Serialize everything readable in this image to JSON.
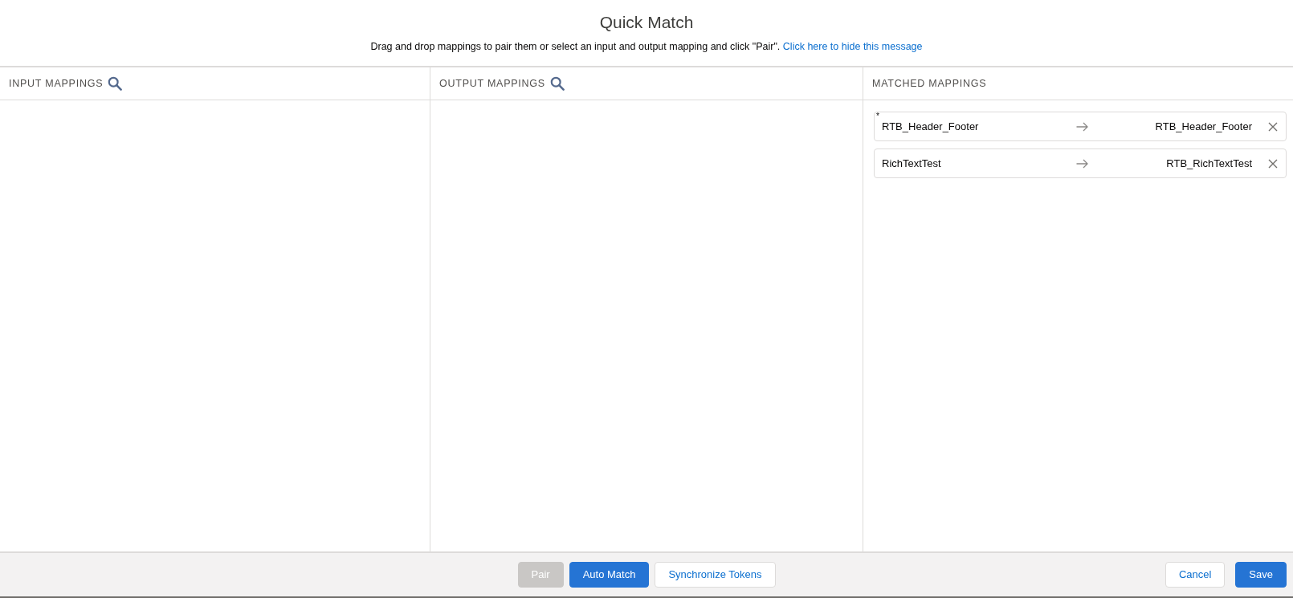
{
  "dialog": {
    "title": "Quick Match",
    "message": "Drag and drop mappings to pair them or select an input and output mapping and click \"Pair\".",
    "message_link": "Click here to hide this message"
  },
  "columns": [
    {
      "label": "INPUT MAPPINGS",
      "searchable": true
    },
    {
      "label": "OUTPUT MAPPINGS",
      "searchable": true
    },
    {
      "label": "MATCHED MAPPINGS",
      "searchable": false
    }
  ],
  "matched_mappings": [
    {
      "marker": "*",
      "input": "RTB_Header_Footer",
      "output": "RTB_Header_Footer"
    },
    {
      "input": "RichTextTest",
      "output": "RTB_RichTextTest"
    }
  ],
  "footer": {
    "center_buttons": [
      {
        "label": "Pair",
        "kind": "brand",
        "disabled": true
      },
      {
        "label": "Auto Match",
        "kind": "brand",
        "disabled": false
      },
      {
        "label": "Synchronize Tokens",
        "kind": "neutral",
        "disabled": false
      }
    ],
    "right_buttons": [
      {
        "label": "Cancel",
        "kind": "neutral",
        "disabled": false
      },
      {
        "label": "Save",
        "kind": "brand",
        "disabled": false
      }
    ]
  }
}
